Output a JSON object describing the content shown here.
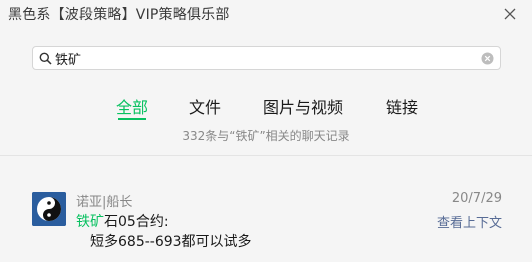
{
  "window": {
    "title": "黑色系【波段策略】VIP策略俱乐部"
  },
  "search": {
    "value": "铁矿"
  },
  "tabs": [
    {
      "label": "全部",
      "active": true
    },
    {
      "label": "文件",
      "active": false
    },
    {
      "label": "图片与视频",
      "active": false
    },
    {
      "label": "链接",
      "active": false
    }
  ],
  "result_summary": "332条与“铁矿”相关的聊天记录",
  "results": [
    {
      "sender": "诺亚|船长",
      "date": "20/7/29",
      "keyword": "铁矿",
      "line1_rest": "石05合约:",
      "line2": "短多685--693都可以试多",
      "context_link": "查看上下文"
    }
  ],
  "colors": {
    "accent": "#07c160",
    "link": "#576b95",
    "muted": "#888888",
    "background": "#f5f5f5"
  },
  "icons": {
    "search": "search-icon",
    "clear": "clear-icon",
    "close": "close-icon",
    "avatar": "yin-yang-avatar"
  }
}
